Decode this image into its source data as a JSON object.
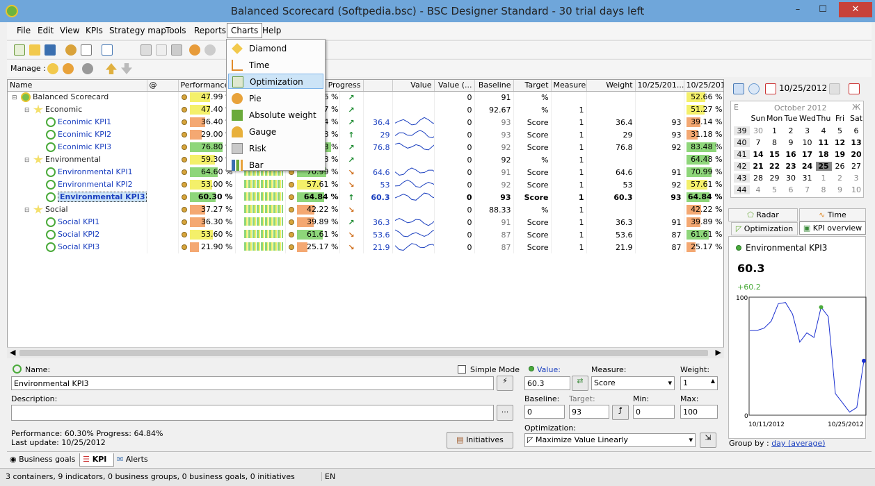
{
  "window": {
    "title": "Balanced Scorecard (Softpedia.bsc) - BSC Designer Standard - 30 trial days left",
    "minimize": "–",
    "maximize": "☐",
    "close": "✕"
  },
  "menu": [
    "File",
    "Edit",
    "View",
    "KPIs",
    "Strategy map",
    "Tools",
    "Reports",
    "Charts",
    "Help"
  ],
  "toolbar": {
    "manage_label": "Manage :"
  },
  "charts_menu": [
    "Diamond",
    "Time",
    "Optimization",
    "Pie",
    "Absolute weight",
    "Gauge",
    "Risk",
    "Bar"
  ],
  "grid": {
    "columns": [
      "Name",
      "@",
      "Performance",
      "Progress",
      "",
      "Value",
      "Value (...",
      "Baseline",
      "Target",
      "Measure",
      "Weight",
      "10/25/201...",
      "10/25/201...",
      "10/25/201..."
    ],
    "rows": [
      {
        "name": "Balanced Scorecard",
        "indent": 0,
        "type": "root",
        "perf": "47.99 %",
        "perf_v": 0.48,
        "prog": "52.66 %",
        "prog_v": 0.53,
        "trend": "up",
        "value": "",
        "baseline": "0",
        "target": "91",
        "measure": "%",
        "weight": "",
        "d1": "",
        "d2": "",
        "d3": "52.66 %",
        "d3_v": 0.53
      },
      {
        "name": "Economic",
        "indent": 1,
        "type": "group",
        "perf": "47.40 %",
        "perf_v": 0.47,
        "prog": "51.27 %",
        "prog_v": 0.51,
        "trend": "up",
        "value": "",
        "baseline": "0",
        "target": "92.67",
        "measure": "%",
        "weight": "1",
        "d1": "",
        "d2": "",
        "d3": "51.27 %",
        "d3_v": 0.51
      },
      {
        "name": "Econimic KPI1",
        "indent": 2,
        "type": "kpi",
        "perf": "36.40 %",
        "perf_v": 0.36,
        "prog": "39.14 %",
        "prog_v": 0.39,
        "trend": "up",
        "value": "36.4",
        "baseline": "0",
        "target": "93",
        "measure": "Score",
        "weight": "1",
        "d1": "36.4",
        "d2": "93",
        "d3": "39.14 %",
        "d3_v": 0.39
      },
      {
        "name": "Econimic KPI2",
        "indent": 2,
        "type": "kpi",
        "perf": "29.00 %",
        "perf_v": 0.29,
        "prog": "31.18 %",
        "prog_v": 0.31,
        "trend": "upb",
        "value": "29",
        "baseline": "0",
        "target": "93",
        "measure": "Score",
        "weight": "1",
        "d1": "29",
        "d2": "93",
        "d3": "31.18 %",
        "d3_v": 0.31
      },
      {
        "name": "Econimic KPI3",
        "indent": 2,
        "type": "kpi",
        "perf": "76.80 %",
        "perf_v": 0.77,
        "prog": "83.48 %",
        "prog_v": 0.83,
        "trend": "up",
        "value": "76.8",
        "baseline": "0",
        "target": "92",
        "measure": "Score",
        "weight": "1",
        "d1": "76.8",
        "d2": "92",
        "d3": "83.48 %",
        "d3_v": 0.83
      },
      {
        "name": "Environmental",
        "indent": 1,
        "type": "group",
        "perf": "59.30 %",
        "perf_v": 0.59,
        "prog": "64.48 %",
        "prog_v": 0.64,
        "trend": "up",
        "value": "",
        "baseline": "0",
        "target": "92",
        "measure": "%",
        "weight": "1",
        "d1": "",
        "d2": "",
        "d3": "64.48 %",
        "d3_v": 0.64
      },
      {
        "name": "Environmental KPI1",
        "indent": 2,
        "type": "kpi",
        "perf": "64.60 %",
        "perf_v": 0.65,
        "prog": "70.99 %",
        "prog_v": 0.71,
        "trend": "dn",
        "value": "64.6",
        "baseline": "0",
        "target": "91",
        "measure": "Score",
        "weight": "1",
        "d1": "64.6",
        "d2": "91",
        "d3": "70.99 %",
        "d3_v": 0.71
      },
      {
        "name": "Environmental KPI2",
        "indent": 2,
        "type": "kpi",
        "perf": "53.00 %",
        "perf_v": 0.53,
        "prog": "57.61 %",
        "prog_v": 0.58,
        "trend": "dn",
        "value": "53",
        "baseline": "0",
        "target": "92",
        "measure": "Score",
        "weight": "1",
        "d1": "53",
        "d2": "92",
        "d3": "57.61 %",
        "d3_v": 0.58
      },
      {
        "name": "Environmental KPI3",
        "indent": 2,
        "type": "kpi",
        "sel": true,
        "perf": "60.30 %",
        "perf_v": 0.6,
        "prog": "64.84 %",
        "prog_v": 0.65,
        "trend": "upb",
        "value": "60.3",
        "baseline": "0",
        "target": "93",
        "measure": "Score",
        "weight": "1",
        "d1": "60.3",
        "d2": "93",
        "d3": "64.84 %",
        "d3_v": 0.65
      },
      {
        "name": "Social",
        "indent": 1,
        "type": "group",
        "perf": "37.27 %",
        "perf_v": 0.37,
        "prog": "42.22 %",
        "prog_v": 0.42,
        "trend": "dn",
        "value": "",
        "baseline": "0",
        "target": "88.33",
        "measure": "%",
        "weight": "1",
        "d1": "",
        "d2": "",
        "d3": "42.22 %",
        "d3_v": 0.42
      },
      {
        "name": "Social KPI1",
        "indent": 2,
        "type": "kpi",
        "perf": "36.30 %",
        "perf_v": 0.36,
        "prog": "39.89 %",
        "prog_v": 0.4,
        "trend": "up",
        "value": "36.3",
        "baseline": "0",
        "target": "91",
        "measure": "Score",
        "weight": "1",
        "d1": "36.3",
        "d2": "91",
        "d3": "39.89 %",
        "d3_v": 0.4
      },
      {
        "name": "Social KPI2",
        "indent": 2,
        "type": "kpi",
        "perf": "53.60 %",
        "perf_v": 0.54,
        "prog": "61.61 %",
        "prog_v": 0.62,
        "trend": "dn",
        "value": "53.6",
        "baseline": "0",
        "target": "87",
        "measure": "Score",
        "weight": "1",
        "d1": "53.6",
        "d2": "87",
        "d3": "61.61 %",
        "d3_v": 0.62
      },
      {
        "name": "Social KPI3",
        "indent": 2,
        "type": "kpi",
        "perf": "21.90 %",
        "perf_v": 0.22,
        "prog": "25.17 %",
        "prog_v": 0.25,
        "trend": "dn",
        "value": "21.9",
        "baseline": "0",
        "target": "87",
        "measure": "Score",
        "weight": "1",
        "d1": "21.9",
        "d2": "87",
        "d3": "25.17 %",
        "d3_v": 0.25
      }
    ]
  },
  "calendar": {
    "date": "10/25/2012",
    "month_label": "October 2012",
    "prev": "E",
    "next": "Ж",
    "days": [
      "Sun",
      "Mon",
      "Tue",
      "Wed",
      "Thu",
      "Fri",
      "Sat"
    ],
    "weeks": [
      {
        "w": "39",
        "d": [
          "30",
          "1",
          "2",
          "3",
          "4",
          "5",
          "6"
        ]
      },
      {
        "w": "40",
        "d": [
          "7",
          "8",
          "9",
          "10",
          "11",
          "12",
          "13"
        ]
      },
      {
        "w": "41",
        "d": [
          "14",
          "15",
          "16",
          "17",
          "18",
          "19",
          "20"
        ]
      },
      {
        "w": "42",
        "d": [
          "21",
          "22",
          "23",
          "24",
          "25",
          "26",
          "27"
        ]
      },
      {
        "w": "43",
        "d": [
          "28",
          "29",
          "30",
          "31",
          "1",
          "2",
          "3"
        ]
      },
      {
        "w": "44",
        "d": [
          "4",
          "5",
          "6",
          "7",
          "8",
          "9",
          "10"
        ]
      }
    ]
  },
  "right_tabs": {
    "radar": "Radar",
    "time": "Time",
    "optimization": "Optimization",
    "kpi_overview": "KPI overview"
  },
  "detail": {
    "name": "Environmental KPI3",
    "value": "60.3",
    "delta": "+60.2",
    "y_max": "100",
    "y_min": "0",
    "x_start": "10/11/2012",
    "x_end": "10/25/2012",
    "series": [
      72,
      72,
      74,
      80,
      95,
      96,
      86,
      62,
      70,
      66,
      92,
      84,
      18,
      10,
      2,
      6,
      46
    ],
    "group_by_label": "Group by :",
    "group_by_value": "day (average)"
  },
  "form": {
    "name_label": "Name:",
    "name_value": "Environmental KPI3",
    "simple_mode": "Simple Mode",
    "description_label": "Description:",
    "value_label": "Value:",
    "value": "60.3",
    "measure_label": "Measure:",
    "measure": "Score",
    "weight_label": "Weight:",
    "weight": "1",
    "baseline_label": "Baseline:",
    "baseline": "0",
    "target_label": "Target:",
    "target": "93",
    "min_label": "Min:",
    "min": "0",
    "max_label": "Max:",
    "max": "100",
    "optimization_label": "Optimization:",
    "optimization": "Maximize Value Linearly",
    "initiatives": "Initiatives",
    "summary1": "Performance: 60.30%  Progress: 64.84%",
    "summary2": "Last update: 10/25/2012",
    "ellipsis": "..."
  },
  "bottom_tabs": [
    "Business goals",
    "KPI",
    "Alerts"
  ],
  "status": {
    "text": "3 containers, 9 indicators, 0 business groups, 0 business goals, 0 initiatives",
    "lang": "EN"
  }
}
